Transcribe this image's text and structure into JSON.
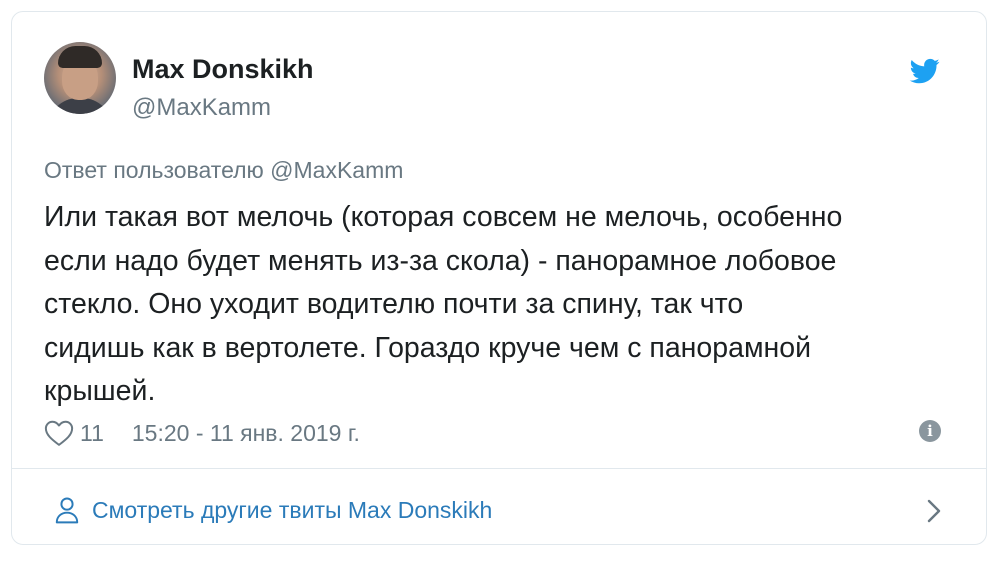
{
  "tweet": {
    "author_name": "Max Donskikh",
    "author_handle": "@MaxKamm",
    "reply_to": "Ответ пользователю @MaxKamm",
    "text": "Или такая вот мелочь (которая совсем не мелочь, особенно\nесли надо будет менять из-за скола) - панорамное лобовое\nстекло. Оно уходит водителю почти за спину, так что\nсидишь как в вертолете. Гораздо круче чем с панорамной\nкрышей.",
    "likes": "11",
    "timestamp": "15:20 - 11 янв. 2019 г.",
    "info_glyph": "i"
  },
  "footer": {
    "more_tweets_label": "Смотреть другие твиты Max Donskikh"
  },
  "icons": {
    "logo": "twitter-bird-icon",
    "like": "heart-icon",
    "info": "info-icon",
    "profile": "user-icon",
    "chevron": "chevron-right-icon"
  },
  "colors": {
    "brand": "#1da1f2",
    "link": "#2b7bb9",
    "secondary_text": "#697882",
    "primary_text": "#1c2022",
    "border": "#e1e8ed"
  }
}
